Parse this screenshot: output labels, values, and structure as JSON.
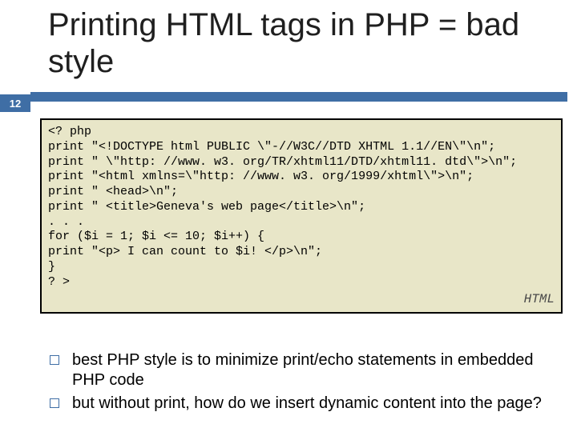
{
  "page_number": "12",
  "title": "Printing HTML tags in PHP = bad style",
  "code": {
    "lines": [
      "<? php",
      "print \"<!DOCTYPE html PUBLIC \\\"-//W3C//DTD XHTML 1.1//EN\\\"\\n\";",
      "print \" \\\"http: //www. w3. org/TR/xhtml11/DTD/xhtml11. dtd\\\">\\n\";",
      "print \"<html xmlns=\\\"http: //www. w3. org/1999/xhtml\\\">\\n\";",
      "print \" <head>\\n\";",
      "print \" <title>Geneva's web page</title>\\n\";",
      ". . .",
      "for ($i = 1; $i <= 10; $i++) {",
      "print \"<p> I can count to $i! </p>\\n\";",
      "}",
      "? >"
    ],
    "lang_tag": "HTML"
  },
  "bullets": [
    "best PHP style is to minimize print/echo statements in embedded PHP code",
    "but without print, how do we insert dynamic content into the page?"
  ]
}
